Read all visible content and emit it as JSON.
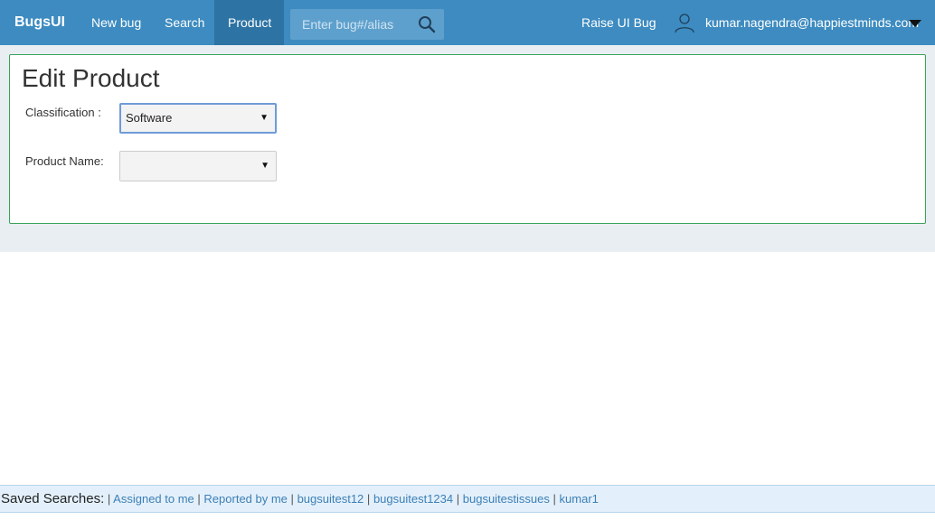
{
  "navbar": {
    "brand": "BugsUI",
    "links": [
      {
        "label": "New bug"
      },
      {
        "label": "Search"
      },
      {
        "label": "Product"
      }
    ],
    "search_placeholder": "Enter bug#/alias",
    "raise_label": "Raise UI Bug",
    "user_email": "kumar.nagendra@happiestminds.com"
  },
  "form": {
    "title": "Edit Product",
    "classification_label": "Classification :",
    "classification_value": "Software",
    "product_label": "Product Name:",
    "product_value": ""
  },
  "footer": {
    "label": "Saved Searches:",
    "searches": [
      "Assigned to me",
      "Reported by me",
      "bugsuitest12",
      "bugsuitest1234",
      "bugsuitestissues",
      "kumar1"
    ]
  },
  "colors": {
    "navbar": "#3d8bc0",
    "active_tab": "#2d73a3",
    "panel_border": "#3aa35a",
    "link": "#3d7fb5"
  }
}
